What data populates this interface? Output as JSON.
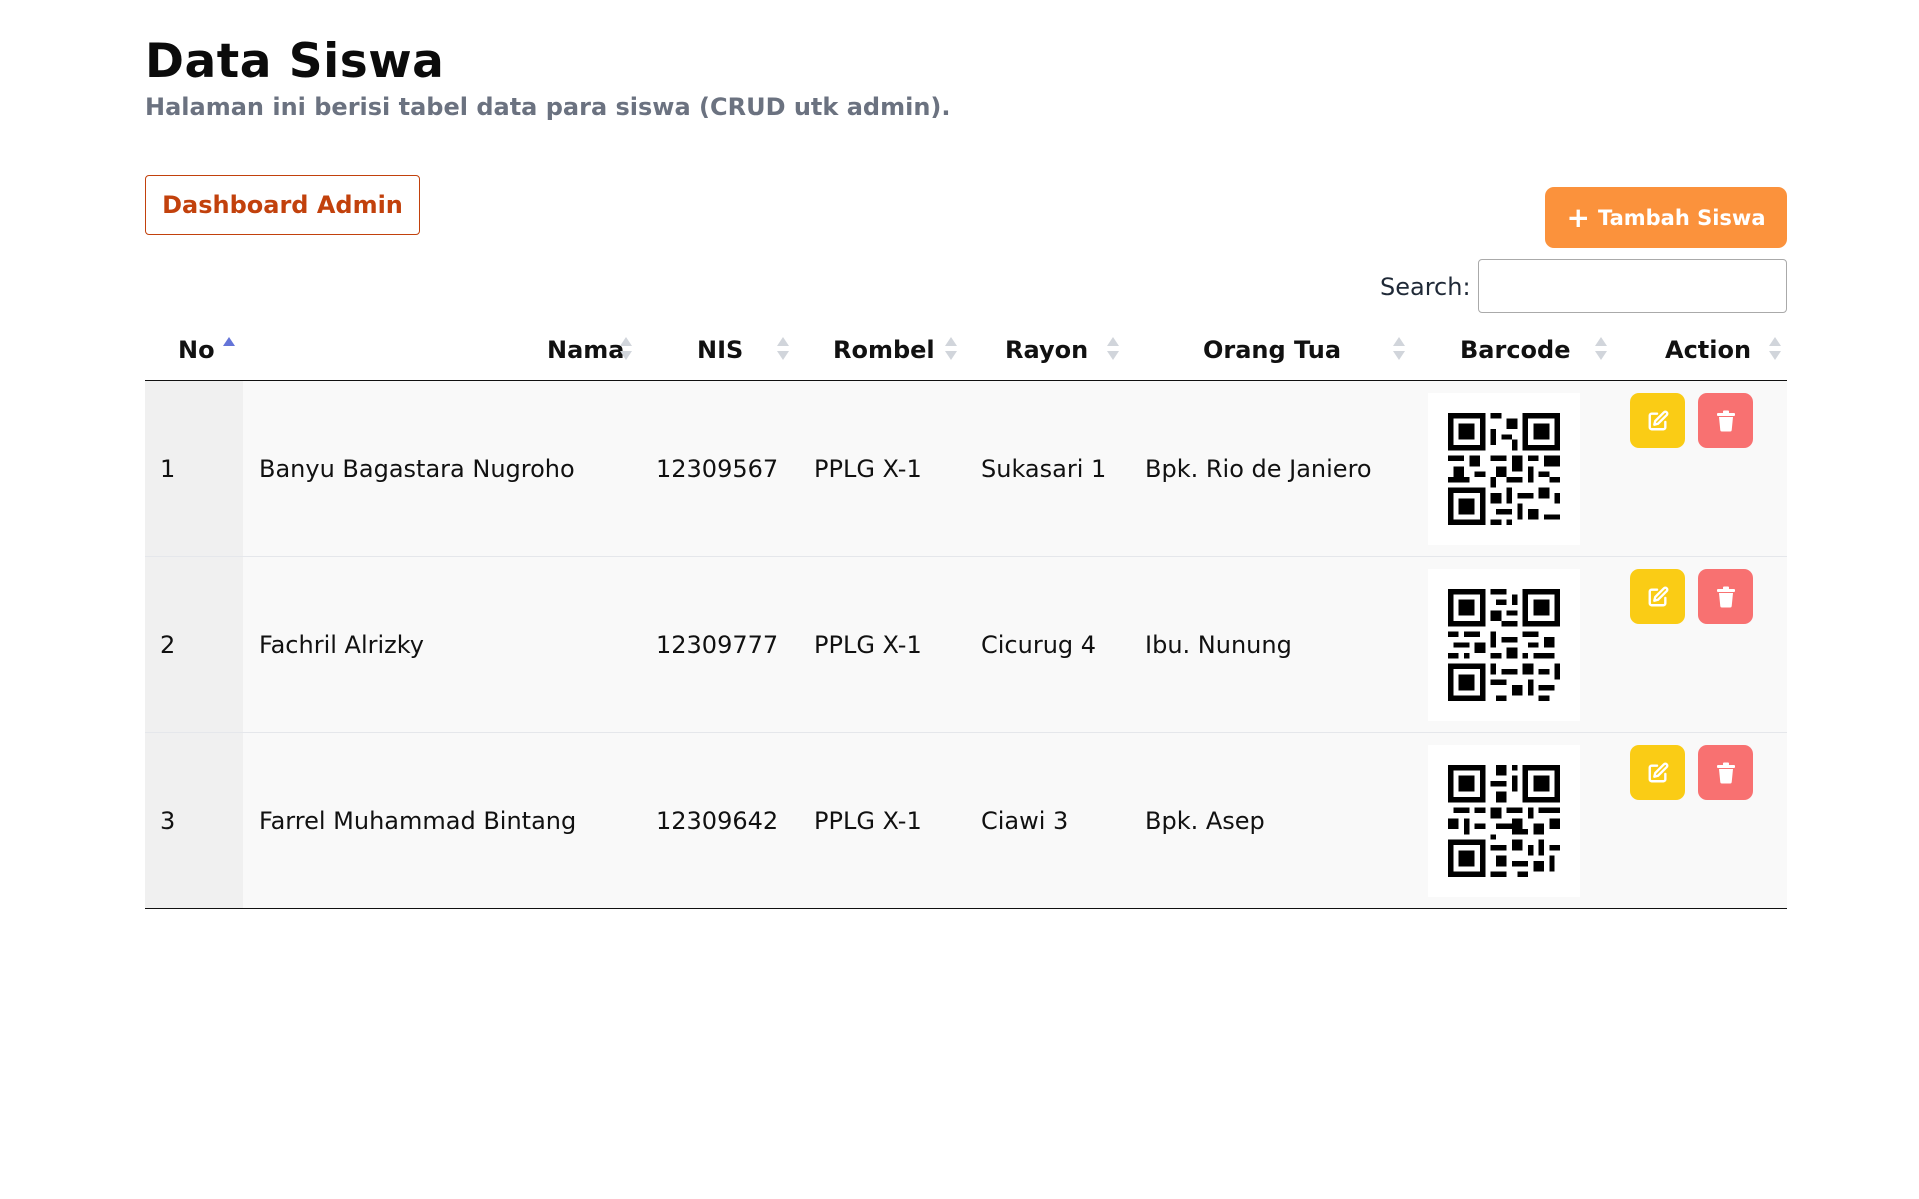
{
  "page": {
    "title": "Data Siswa",
    "subtitle": "Halaman ini berisi tabel data para siswa (CRUD utk admin)."
  },
  "toolbar": {
    "dashboard_label": "Dashboard Admin",
    "add_label": "Tambah Siswa",
    "search_label": "Search:",
    "search_value": ""
  },
  "table": {
    "columns": [
      "No",
      "Nama",
      "NIS",
      "Rombel",
      "Rayon",
      "Orang Tua",
      "Barcode",
      "Action"
    ],
    "sorted_column": "No",
    "sort_direction": "ascending",
    "rows": [
      {
        "no": "1",
        "nama": "Banyu Bagastara Nugroho",
        "nis": "12309567",
        "rombel": "PPLG X-1",
        "rayon": "Sukasari 1",
        "orang_tua": "Bpk. Rio de Janiero"
      },
      {
        "no": "2",
        "nama": "Fachril Alrizky",
        "nis": "12309777",
        "rombel": "PPLG X-1",
        "rayon": "Cicurug 4",
        "orang_tua": "Ibu. Nunung"
      },
      {
        "no": "3",
        "nama": "Farrel Muhammad Bintang",
        "nis": "12309642",
        "rombel": "PPLG X-1",
        "rayon": "Ciawi 3",
        "orang_tua": "Bpk. Asep"
      }
    ]
  },
  "icons": {
    "add": "plus-icon",
    "edit": "edit-icon",
    "delete": "trash-icon",
    "barcode": "qr-code-icon"
  },
  "colors": {
    "accent_orange": "#fb923c",
    "dashboard_border": "#c2410c",
    "edit_button": "#facc15",
    "delete_button": "#f87171",
    "sort_active": "#6474d8"
  }
}
